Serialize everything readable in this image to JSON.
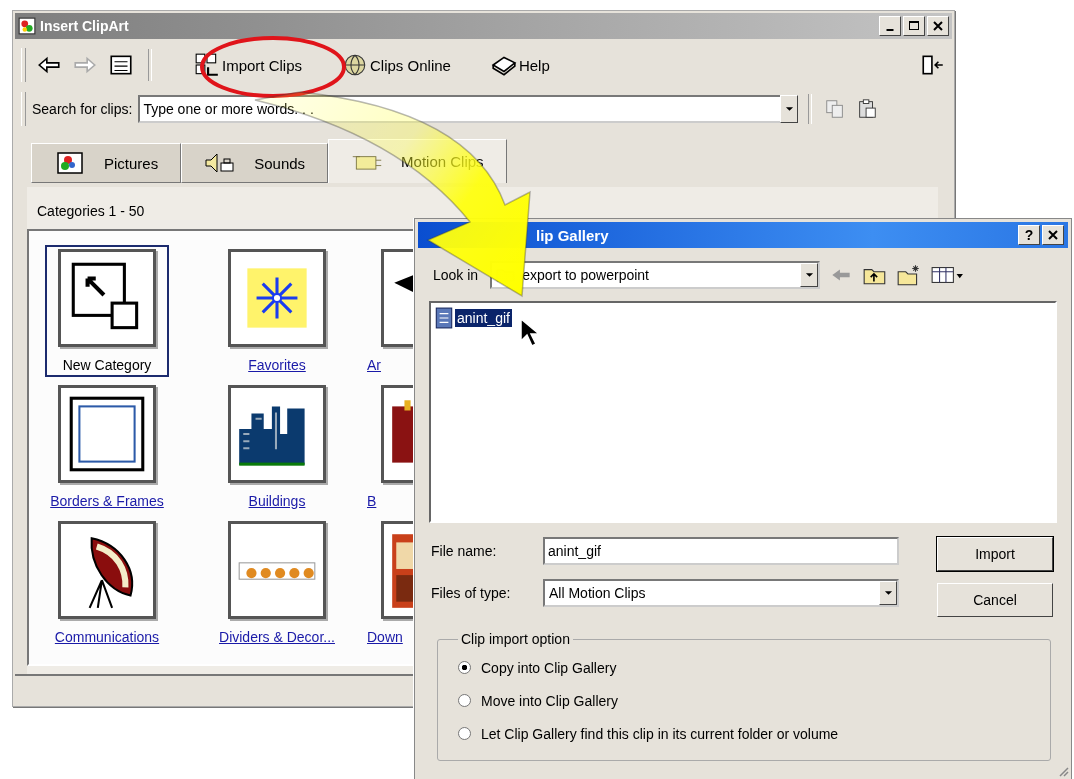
{
  "main_window": {
    "title": "Insert ClipArt",
    "toolbar": [
      {
        "label": "Import Clips",
        "kind": "import"
      },
      {
        "label": "Clips Online",
        "kind": "online"
      },
      {
        "label": "Help",
        "kind": "help"
      }
    ],
    "search": {
      "label": "Search for clips:",
      "placeholder": "Type one or more words. . ."
    },
    "tabs": [
      {
        "label": "Pictures",
        "kind": "pictures",
        "selected": false
      },
      {
        "label": "Sounds",
        "kind": "sounds",
        "selected": false
      },
      {
        "label": "Motion Clips",
        "kind": "motion",
        "selected": true
      }
    ],
    "range": "Categories 1 - 50",
    "categories": [
      {
        "label": "New Category",
        "kind": "new",
        "selected": true
      },
      {
        "label": "Favorites",
        "kind": "favorites",
        "selected": false
      },
      {
        "label": "Ar",
        "kind": "flag",
        "selected": false
      },
      {
        "label": "Borders & Frames",
        "kind": "borders",
        "selected": false
      },
      {
        "label": "Buildings",
        "kind": "buildings",
        "selected": false
      },
      {
        "label": "B",
        "kind": "red",
        "selected": false
      },
      {
        "label": "Communications",
        "kind": "dish",
        "selected": false
      },
      {
        "label": "Dividers & Decor...",
        "kind": "dividers",
        "selected": false
      },
      {
        "label": "Down",
        "kind": "poster",
        "selected": false
      }
    ]
  },
  "dialog": {
    "title": "lip Gallery",
    "help_glyph": "?",
    "look_in": {
      "label": "Look in",
      "value": "export to powerpoint"
    },
    "files": [
      {
        "name": "anint_gif",
        "selected": true
      }
    ],
    "file_name": {
      "label": "File name:",
      "value": "anint_gif"
    },
    "file_type": {
      "label": "Files of type:",
      "value": "All Motion Clips"
    },
    "buttons": [
      {
        "label": "Import",
        "default": true
      },
      {
        "label": "Cancel",
        "default": false
      }
    ],
    "option_group": {
      "title": "Clip import option",
      "options": [
        {
          "label": "Copy into Clip Gallery",
          "selected": true
        },
        {
          "label": "Move into Clip Gallery",
          "selected": false
        },
        {
          "label": "Let Clip Gallery find this clip in its current folder or volume",
          "selected": false
        }
      ]
    }
  }
}
